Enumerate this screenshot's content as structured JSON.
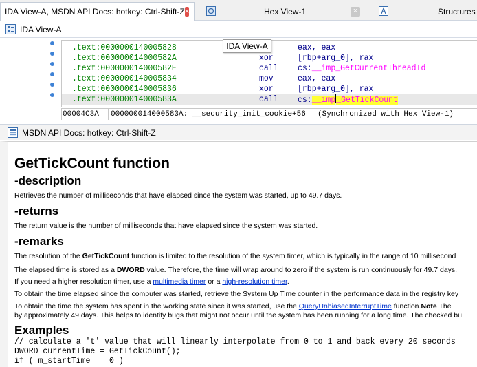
{
  "tabs": [
    {
      "label": "IDA View-A, MSDN API Docs: hotkey: Ctrl-Shift-Z",
      "close": "×"
    },
    {
      "label": "Hex View-1",
      "close": "×"
    },
    {
      "label": "Structures"
    }
  ],
  "ida": {
    "title": "IDA View-A",
    "tooltip": "IDA View-A",
    "lines": [
      {
        "addr": ".text:0000000140005828",
        "mn": "",
        "op": "eax, eax"
      },
      {
        "addr": ".text:000000014000582A",
        "mn": "xor",
        "op": "[rbp+arg_0], rax"
      },
      {
        "addr": ".text:000000014000582E",
        "mn": "call",
        "op_prefix": "cs:",
        "op_imp": "__imp_GetCurrentThreadId"
      },
      {
        "addr": ".text:0000000140005834",
        "mn": "mov",
        "op": "eax, eax"
      },
      {
        "addr": ".text:0000000140005836",
        "mn": "xor",
        "op": "[rbp+arg_0], rax"
      },
      {
        "addr": ".text:000000014000583A",
        "mn": "call",
        "op_prefix": "cs:",
        "op_imp_a": "__imp",
        "op_imp_b": "_GetTickCount"
      }
    ],
    "status": {
      "offset": "00004C3A",
      "location": "000000014000583A: __security_init_cookie+56",
      "sync": "(Synchronized with Hex View-1)"
    }
  },
  "msdn": {
    "title": "MSDN API Docs: hotkey: Ctrl-Shift-Z",
    "heading": "GetTickCount function",
    "sections": {
      "description": "-description",
      "returns": "-returns",
      "remarks": "-remarks",
      "examples": "Examples"
    },
    "description_text": "Retrieves the number of milliseconds that have elapsed since the system was started, up to 49.7 days.",
    "returns_text": "The return value is the number of milliseconds that have elapsed since the system was started.",
    "remarks": {
      "p1_a": "The resolution of the ",
      "p1_b": "GetTickCount",
      "p1_c": " function is limited to the resolution of the system timer, which is typically in the range of  10 millisecond",
      "p2_a": "The elapsed time is stored as a ",
      "p2_b": "DWORD",
      "p2_c": " value. Therefore, the time will wrap around to zero if the system is run continuously for 49.7 days.",
      "p3_a": "If you need a higher resolution timer, use a ",
      "p3_link1": "multimedia timer",
      "p3_b": " or a ",
      "p3_link2": "high-resolution timer",
      "p3_c": ".",
      "p4": "To obtain the time elapsed since the computer was started, retrieve the System Up Time counter in the performance data in the registry key",
      "p5_a": "To obtain the time the system has spent in the working state since it was started, use the ",
      "p5_link": "QueryUnbiasedInterruptTime",
      "p5_b": " function.",
      "p5_note": "Note",
      "p5_c": "  The",
      "p6": "by approximately 49 days. This helps to identify bugs that might not occur until the system has been running for a long time. The checked bu"
    },
    "code": [
      "// calculate a 't' value that will linearly interpolate from 0 to 1 and back every 20 seconds",
      "DWORD currentTime = GetTickCount();",
      "if ( m_startTime == 0 )"
    ]
  }
}
